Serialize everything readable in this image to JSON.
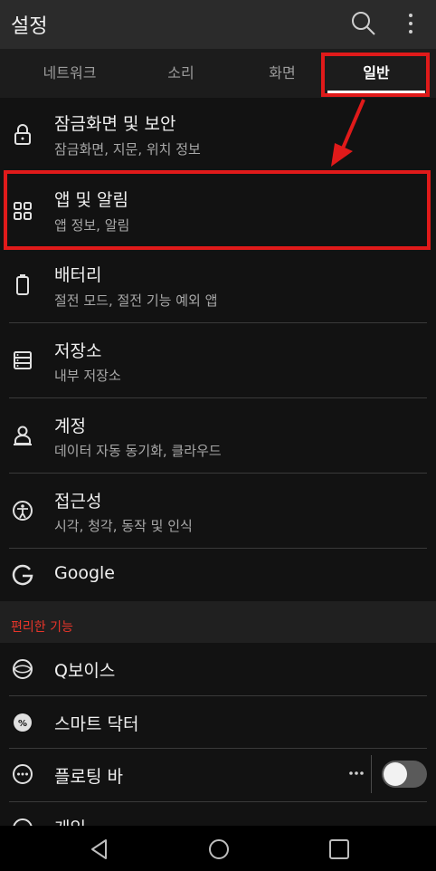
{
  "appbar": {
    "title": "설정",
    "icons": [
      "search-icon",
      "more-vert-icon"
    ]
  },
  "tabs": [
    {
      "label": "네트워크",
      "active": false
    },
    {
      "label": "소리",
      "active": false
    },
    {
      "label": "화면",
      "active": false
    },
    {
      "label": "일반",
      "active": true
    }
  ],
  "items": [
    {
      "label": "잠금화면 및 보안",
      "sub": "잠금화면, 지문, 위치 정보",
      "icon": "lock-icon"
    },
    {
      "label": "앱 및 알림",
      "sub": "앱 정보, 알림",
      "icon": "apps-grid-icon"
    },
    {
      "label": "배터리",
      "sub": "절전 모드, 절전 기능 예외 앱",
      "icon": "battery-icon"
    },
    {
      "label": "저장소",
      "sub": "내부 저장소",
      "icon": "storage-icon"
    },
    {
      "label": "계정",
      "sub": "데이터 자동 동기화, 클라우드",
      "icon": "account-icon"
    },
    {
      "label": "접근성",
      "sub": "시각, 청각, 동작 및 인식",
      "icon": "accessibility-icon"
    },
    {
      "label": "Google",
      "sub": "",
      "icon": "google-icon"
    }
  ],
  "section": {
    "title": "편리한 기능"
  },
  "convenience": [
    {
      "label": "Q보이스",
      "icon": "qvoice-icon"
    },
    {
      "label": "스마트 닥터",
      "icon": "smart-doctor-icon"
    },
    {
      "label": "플로팅 바",
      "icon": "floating-bar-icon",
      "toggle_on": false
    },
    {
      "label": "게임",
      "icon": "game-icon"
    }
  ],
  "navbar": {
    "icons": [
      "back-icon",
      "home-icon",
      "recents-icon"
    ]
  },
  "colors": {
    "accent": "#e01a1a",
    "section_header": "#e8352a",
    "background": "#121212"
  }
}
